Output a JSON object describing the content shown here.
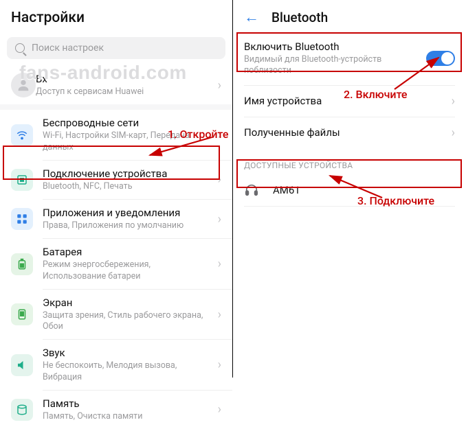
{
  "watermark": "fans-android.com",
  "annotations": {
    "step1": "1. Откройте",
    "step2": "2. Включите",
    "step3": "3. Подключите"
  },
  "left": {
    "title": "Настройки",
    "search_placeholder": "Поиск настроек",
    "account": {
      "title_visible": "Вх",
      "subtitle": "Доступ к сервисам Huawei"
    },
    "items": [
      {
        "title": "Беспроводные сети",
        "subtitle": "Wi-Fi, Настройки SIM-карт, Передача данных"
      },
      {
        "title": "Подключение устройства",
        "subtitle": "Bluetooth, NFC, Печать"
      },
      {
        "title": "Приложения и уведомления",
        "subtitle": "Права, Приложения по умолчанию"
      },
      {
        "title": "Батарея",
        "subtitle": "Режим энергосбережения, Использование батареи"
      },
      {
        "title": "Экран",
        "subtitle": "Защита зрения, Стиль рабочего экрана, Обои"
      },
      {
        "title": "Звук",
        "subtitle": "Не беспокоить, Мелодия вызова, Вибрация"
      },
      {
        "title": "Память",
        "subtitle": "Память, Очистка памяти"
      }
    ]
  },
  "right": {
    "title": "Bluetooth",
    "bt_enable": {
      "title": "Включить Bluetooth",
      "subtitle": "Видимый для Bluetooth-устройств поблизости"
    },
    "device_name_label": "Имя устройства",
    "received_files_label": "Полученные файлы",
    "available_header": "ДОСТУПНЫЕ УСТРОЙСТВА",
    "devices": [
      {
        "name": "AM61"
      }
    ]
  }
}
